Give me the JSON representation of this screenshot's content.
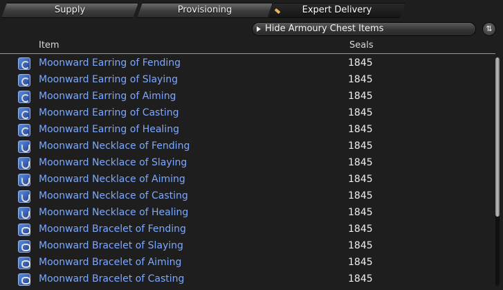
{
  "tabs": [
    {
      "label": "Supply",
      "active": false
    },
    {
      "label": "Provisioning",
      "active": false
    },
    {
      "label": "Expert Delivery",
      "active": true
    }
  ],
  "filter_button": {
    "label": "Hide Armoury Chest Items",
    "icon": "play-triangle-icon"
  },
  "sort_button": {
    "icon": "sort-arrows-icon",
    "glyph": "⇅"
  },
  "header": {
    "item": "Item",
    "seals": "Seals"
  },
  "items": [
    {
      "name": "Moonward Earring of Fending",
      "seals": "1845",
      "icon": "earring-icon"
    },
    {
      "name": "Moonward Earring of Slaying",
      "seals": "1845",
      "icon": "earring-icon"
    },
    {
      "name": "Moonward Earring of Aiming",
      "seals": "1845",
      "icon": "earring-icon"
    },
    {
      "name": "Moonward Earring of Casting",
      "seals": "1845",
      "icon": "earring-icon"
    },
    {
      "name": "Moonward Earring of Healing",
      "seals": "1845",
      "icon": "earring-icon"
    },
    {
      "name": "Moonward Necklace of Fending",
      "seals": "1845",
      "icon": "necklace-icon"
    },
    {
      "name": "Moonward Necklace of Slaying",
      "seals": "1845",
      "icon": "necklace-icon"
    },
    {
      "name": "Moonward Necklace of Aiming",
      "seals": "1845",
      "icon": "necklace-icon"
    },
    {
      "name": "Moonward Necklace of Casting",
      "seals": "1845",
      "icon": "necklace-icon"
    },
    {
      "name": "Moonward Necklace of Healing",
      "seals": "1845",
      "icon": "necklace-icon"
    },
    {
      "name": "Moonward Bracelet of Fending",
      "seals": "1845",
      "icon": "bracelet-icon"
    },
    {
      "name": "Moonward Bracelet of Slaying",
      "seals": "1845",
      "icon": "bracelet-icon"
    },
    {
      "name": "Moonward Bracelet of Aiming",
      "seals": "1845",
      "icon": "bracelet-icon"
    },
    {
      "name": "Moonward Bracelet of Casting",
      "seals": "1845",
      "icon": "bracelet-icon"
    }
  ],
  "colors": {
    "item_link": "#7ca8ff",
    "background": "#1e1e1e",
    "tab_marker": "#e9b64a"
  }
}
